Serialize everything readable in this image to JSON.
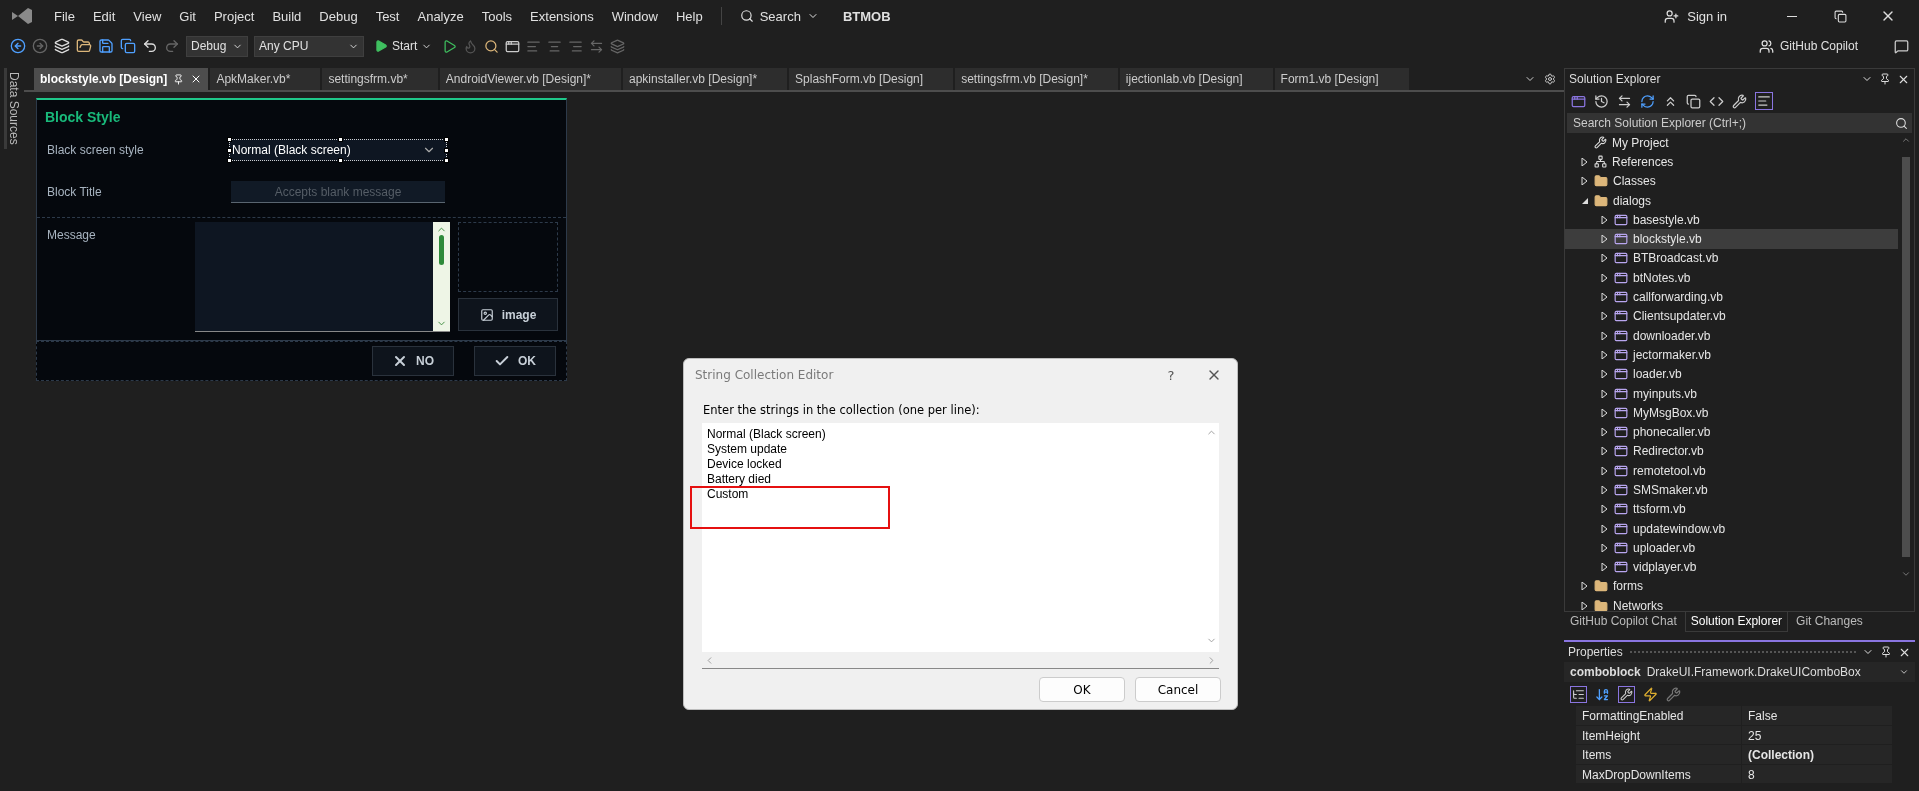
{
  "menu": [
    "File",
    "Edit",
    "View",
    "Git",
    "Project",
    "Build",
    "Debug",
    "Test",
    "Analyze",
    "Tools",
    "Extensions",
    "Window",
    "Help"
  ],
  "search_label": "Search",
  "app_title": "BTMOB",
  "account": "Sign in",
  "toolbar": {
    "configuration": "Debug",
    "platform": "Any CPU",
    "start": "Start",
    "copilot": "GitHub Copilot"
  },
  "side_strip": "Data Sources",
  "tabs": [
    {
      "label": "blockstyle.vb [Design]",
      "selected": true
    },
    {
      "label": "ApkMaker.vb*",
      "selected": false
    },
    {
      "label": "settingsfrm.vb*",
      "selected": false
    },
    {
      "label": "AndroidViewer.vb [Design]*",
      "selected": false
    },
    {
      "label": "apkinstaller.vb [Design]*",
      "selected": false
    },
    {
      "label": "SplashForm.vb [Design]",
      "selected": false
    },
    {
      "label": "settingsfrm.vb [Design]*",
      "selected": false
    },
    {
      "label": "ijectionlab.vb [Design]",
      "selected": false
    },
    {
      "label": "Form1.vb [Design]",
      "selected": false
    }
  ],
  "form": {
    "title": "Block Style",
    "style_label": "Black screen style",
    "style_value": "Normal (Black screen)",
    "title_label": "Block Title",
    "title_placeholder": "Accepts blank message",
    "message_label": "Message",
    "image_button": "image",
    "no_button": "NO",
    "ok_button": "OK"
  },
  "dialog": {
    "title": "String Collection Editor",
    "help": "?",
    "prompt": "Enter the strings in the collection (one per line):",
    "lines": [
      "Normal (Black screen)",
      "System update",
      "Device locked",
      "Battery died",
      "Custom"
    ],
    "ok": "OK",
    "cancel": "Cancel"
  },
  "solution_explorer": {
    "title": "Solution Explorer",
    "search_placeholder": "Search Solution Explorer (Ctrl+;)",
    "items": [
      {
        "label": "My Project",
        "kind": "settings",
        "selected": false
      },
      {
        "label": "References",
        "kind": "references",
        "expanded": false,
        "selected": false
      },
      {
        "label": "Classes",
        "kind": "folder",
        "expanded": false,
        "selected": false
      },
      {
        "label": "dialogs",
        "kind": "folder",
        "expanded": true,
        "selected": false,
        "children": [
          {
            "label": "basestyle.vb",
            "kind": "form",
            "expanded": false,
            "selected": false
          },
          {
            "label": "blockstyle.vb",
            "kind": "form",
            "expanded": false,
            "selected": true
          },
          {
            "label": "BTBroadcast.vb",
            "kind": "form",
            "expanded": false,
            "selected": false
          },
          {
            "label": "btNotes.vb",
            "kind": "form",
            "expanded": false,
            "selected": false
          },
          {
            "label": "callforwarding.vb",
            "kind": "form",
            "expanded": false,
            "selected": false
          },
          {
            "label": "Clientsupdater.vb",
            "kind": "form",
            "expanded": false,
            "selected": false
          },
          {
            "label": "downloader.vb",
            "kind": "form",
            "expanded": false,
            "selected": false
          },
          {
            "label": "jectormaker.vb",
            "kind": "form",
            "expanded": false,
            "selected": false
          },
          {
            "label": "loader.vb",
            "kind": "form",
            "expanded": false,
            "selected": false
          },
          {
            "label": "myinputs.vb",
            "kind": "form",
            "expanded": false,
            "selected": false
          },
          {
            "label": "MyMsgBox.vb",
            "kind": "form",
            "expanded": false,
            "selected": false
          },
          {
            "label": "phonecaller.vb",
            "kind": "form",
            "expanded": false,
            "selected": false
          },
          {
            "label": "Redirector.vb",
            "kind": "form",
            "expanded": false,
            "selected": false
          },
          {
            "label": "remotetool.vb",
            "kind": "form",
            "expanded": false,
            "selected": false
          },
          {
            "label": "SMSmaker.vb",
            "kind": "form",
            "expanded": false,
            "selected": false
          },
          {
            "label": "ttsform.vb",
            "kind": "form",
            "expanded": false,
            "selected": false
          },
          {
            "label": "updatewindow.vb",
            "kind": "form",
            "expanded": false,
            "selected": false
          },
          {
            "label": "uploader.vb",
            "kind": "form",
            "expanded": false,
            "selected": false
          },
          {
            "label": "vidplayer.vb",
            "kind": "form",
            "expanded": false,
            "selected": false
          }
        ]
      },
      {
        "label": "forms",
        "kind": "folder",
        "expanded": false,
        "selected": false
      },
      {
        "label": "Networks",
        "kind": "folder",
        "expanded": false,
        "selected": false
      }
    ]
  },
  "panel_tabs": [
    {
      "label": "GitHub Copilot Chat",
      "selected": false
    },
    {
      "label": "Solution Explorer",
      "selected": true
    },
    {
      "label": "Git Changes",
      "selected": false
    }
  ],
  "properties": {
    "title": "Properties",
    "object_name": "comboblock",
    "object_type": "DrakeUI.Framework.DrakeUIComboBox",
    "rows": [
      {
        "name": "FormattingEnabled",
        "value": "False",
        "modified": false
      },
      {
        "name": "ItemHeight",
        "value": "25",
        "modified": false
      },
      {
        "name": "Items",
        "value": "(Collection)",
        "modified": true
      },
      {
        "name": "MaxDropDownItems",
        "value": "8",
        "modified": false
      }
    ]
  }
}
